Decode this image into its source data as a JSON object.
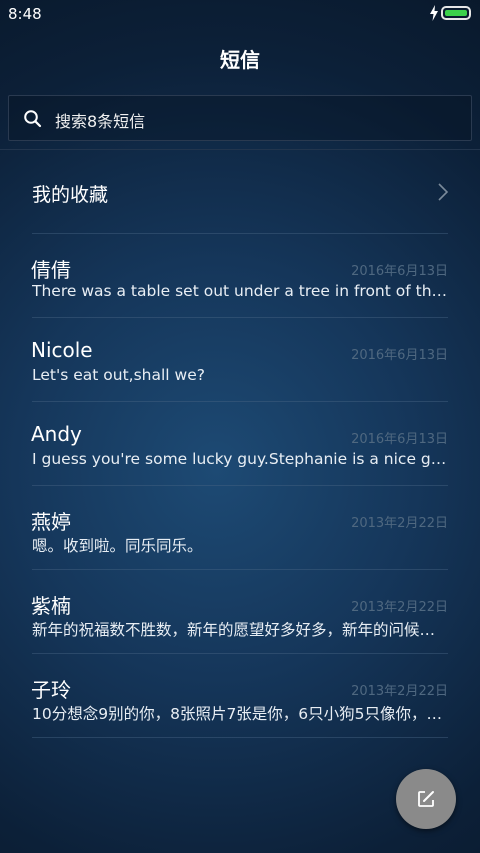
{
  "status_bar": {
    "time": "8:48",
    "battery_color": "#3bd14a"
  },
  "header": {
    "title": "短信"
  },
  "search": {
    "placeholder": "搜索8条短信",
    "icon": "search-icon"
  },
  "favorites": {
    "label": "我的收藏",
    "icon": "chevron-right-icon"
  },
  "threads": [
    {
      "name": "倩倩",
      "date": "2016年6月13日",
      "preview": "There was a table set out under a tree in front of the house, and the March Hare and the Hatter were having tea at it"
    },
    {
      "name": "Nicole",
      "date": "2016年6月13日",
      "preview": "Let's eat out,shall we?"
    },
    {
      "name": "Andy",
      "date": "2016年6月13日",
      "preview": "I guess you're some lucky guy.Stephanie is a nice girl."
    },
    {
      "name": "燕婷",
      "date": "2013年2月22日",
      "preview": "嗯。收到啦。同乐同乐。"
    },
    {
      "name": "紫楠",
      "date": "2013年2月22日",
      "preview": "新年的祝福数不胜数，新年的愿望好多好多，新年的问候送给你"
    },
    {
      "name": "子玲",
      "date": "2013年2月22日",
      "preview": "10分想念9别的你，8张照片7张是你，6只小狗5只像你，4季都想你"
    }
  ],
  "fab": {
    "icon": "compose-icon"
  }
}
